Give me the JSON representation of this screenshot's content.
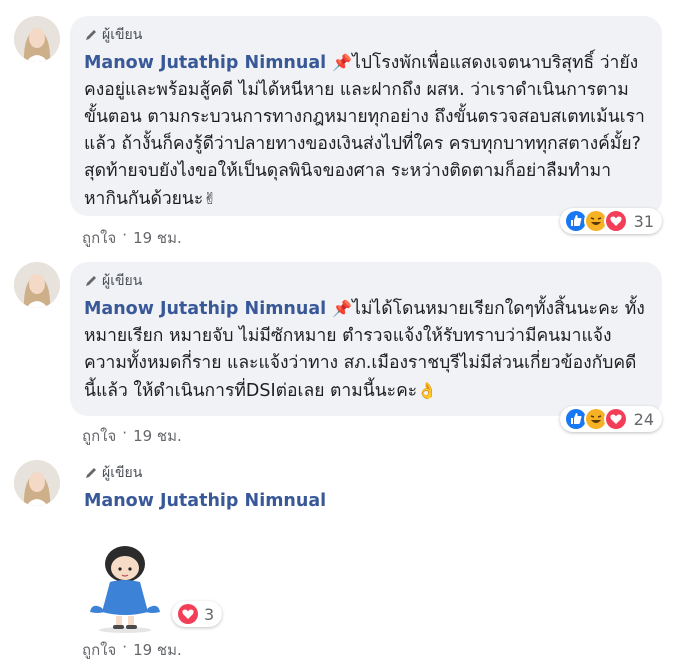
{
  "comments": [
    {
      "author_tag": "ผู้เขียน",
      "name": "Manow Jutathip Nimnual",
      "pin_emoji": "📌",
      "text": "ไปโรงพักเพื่อแสดงเจตนาบริสุทธิ์ ว่ายังคงอยู่และพร้อมสู้คดี ไม่ได้หนีหาย และฝากถึง ผสห. ว่าเราดำเนินการตามขั้นตอน ตามกระบวนการทางกฎหมายทุกอย่าง ถึงขั้นตรวจสอบสเตทเม้นเราแล้ว ถ้างั้นก็คงรู้ดีว่าปลายทางของเงินส่งไปที่ใคร ครบทุกบาททุกสตางค์มั้ย? สุดท้ายจบยังไงขอให้เป็นดุลพินิจของศาล ระหว่างติดตามก็อย่าลืมทำมาหากินกันด้วยนะ",
      "end_emoji": "✌",
      "reaction_count": "31",
      "like_label": "ถูกใจ",
      "dot": "·",
      "time": "19 ชม."
    },
    {
      "author_tag": "ผู้เขียน",
      "name": "Manow Jutathip Nimnual",
      "pin_emoji": "📌",
      "text": "ไม่ได้โดนหมายเรียกใดๆทั้งสิ้นนะคะ ทั้งหมายเรียก หมายจับ ไม่มีซักหมาย ตำรวจแจ้งให้รับทราบว่ามีคนมาแจ้งความทั้งหมดกี่ราย และแจ้งว่าทาง สภ.เมืองราชบุรีไม่มีส่วนเกี่ยวข้องกับคดีนี้แล้ว ให้ดำเนินการที่DSIต่อเลย ตามนี้นะคะ",
      "end_emoji": "👌",
      "reaction_count": "24",
      "like_label": "ถูกใจ",
      "dot": "·",
      "time": "19 ชม."
    },
    {
      "author_tag": "ผู้เขียน",
      "name": "Manow Jutathip Nimnual",
      "reaction_count": "3",
      "like_label": "ถูกใจ",
      "dot": "·",
      "time": "19 ชม."
    }
  ],
  "colors": {
    "name": "#385898",
    "bubble": "#f0f2f5",
    "like": "#1877f2",
    "love": "#f33e58",
    "haha": "#f7b125"
  },
  "icons": [
    "pencil-icon",
    "like-reaction-icon",
    "haha-reaction-icon",
    "love-reaction-icon",
    "avatar",
    "sticker"
  ]
}
